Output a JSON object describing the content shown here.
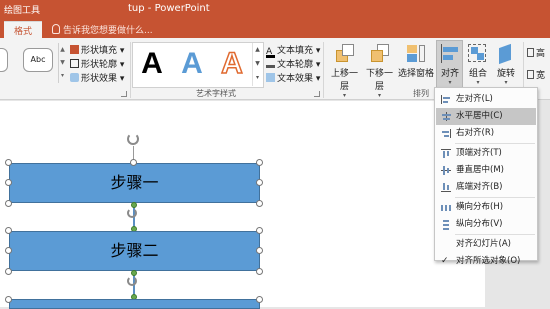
{
  "window": {
    "context_tab_group": "绘图工具",
    "title": "tup - PowerPoint"
  },
  "ribbon_tabs": {
    "format": "格式",
    "tell_me": "告诉我您想要做什么..."
  },
  "shape_styles": {
    "thumb_label": "Abc",
    "fill": "形状填充",
    "outline": "形状轮廓",
    "effects": "形状效果"
  },
  "wordart": {
    "group_label": "艺术字样式",
    "sample": "A",
    "text_fill": "文本填充",
    "text_outline": "文本轮廓",
    "text_effects": "文本效果"
  },
  "arrange": {
    "group_label": "排列",
    "bring_forward": "上移一层",
    "send_backward": "下移一层",
    "selection_pane": "选择窗格",
    "align": "对齐",
    "group": "组合",
    "rotate": "旋转",
    "height": "高",
    "width": "宽"
  },
  "slide": {
    "steps": [
      "步骤一",
      "步骤二"
    ]
  },
  "align_menu": {
    "items": [
      {
        "label": "左对齐(L)",
        "icon": "align-left-icon"
      },
      {
        "label": "水平居中(C)",
        "icon": "align-center-icon",
        "highlighted": true
      },
      {
        "label": "右对齐(R)",
        "icon": "align-right-icon"
      },
      {
        "label": "顶端对齐(T)",
        "icon": "align-top-icon"
      },
      {
        "label": "垂直居中(M)",
        "icon": "align-middle-icon"
      },
      {
        "label": "底端对齐(B)",
        "icon": "align-bottom-icon"
      },
      {
        "label": "横向分布(H)",
        "icon": "distribute-horizontal-icon"
      },
      {
        "label": "纵向分布(V)",
        "icon": "distribute-vertical-icon"
      },
      {
        "label": "对齐幻灯片(A)",
        "icon": ""
      },
      {
        "label": "对齐所选对象(O)",
        "icon": "checkmark-icon",
        "checked": true
      }
    ]
  },
  "colors": {
    "accent": "#c65332",
    "shape_fill": "#5b9bd5"
  }
}
